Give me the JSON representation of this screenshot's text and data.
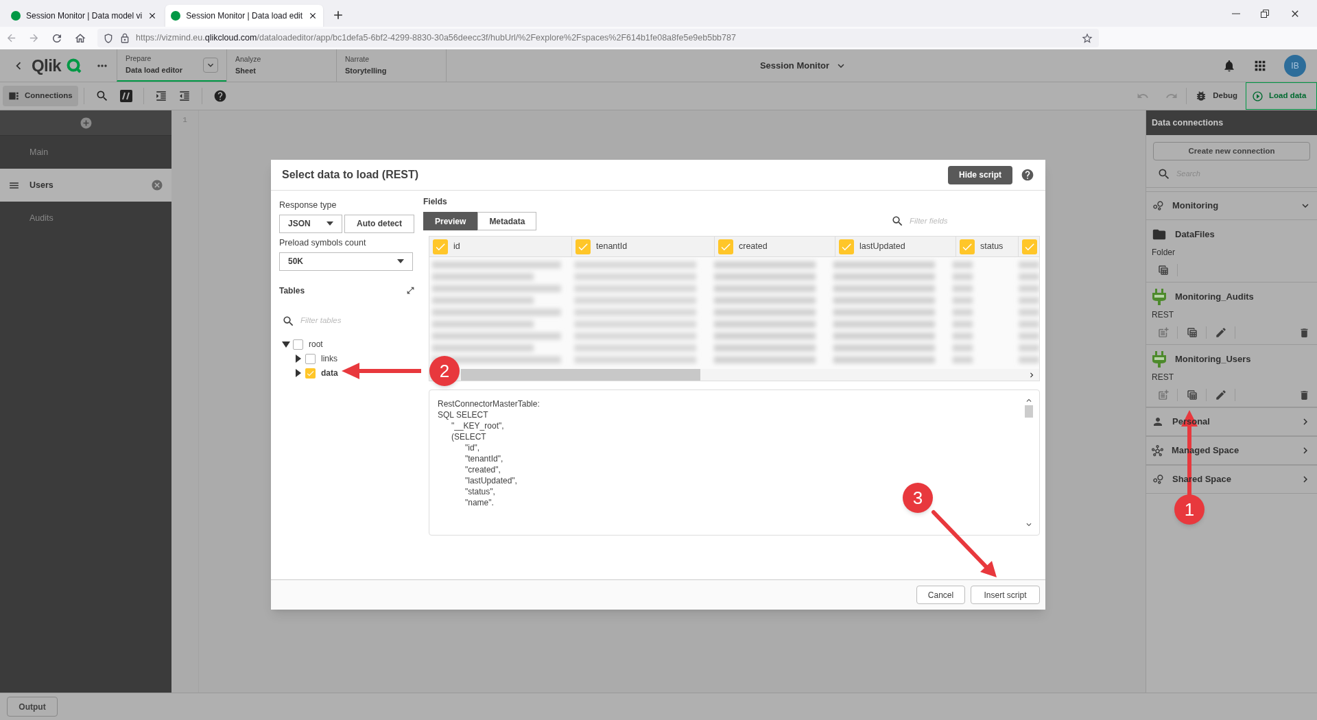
{
  "browser": {
    "tabs": [
      {
        "title": "Session Monitor | Data model vi",
        "selected": false
      },
      {
        "title": "Session Monitor | Data load edit",
        "selected": true
      }
    ],
    "url": {
      "prefix": "https://vizmind.eu.",
      "domain": "qlikcloud.com",
      "path": "/dataloadeditor/app/bc1defa5-6bf2-4299-8830-30a56deecc3f/hubUrl/%2Fexplore%2Fspaces%2F614b1fe08a8fe5e9eb5bb787"
    }
  },
  "header": {
    "logo": "Qlik",
    "nav": [
      {
        "section": "Prepare",
        "label": "Data load editor",
        "selected": true,
        "dropdown": true
      },
      {
        "section": "Analyze",
        "label": "Sheet",
        "selected": false,
        "dropdown": false
      },
      {
        "section": "Narrate",
        "label": "Storytelling",
        "selected": false,
        "dropdown": false
      }
    ],
    "app_title": "Session Monitor",
    "avatar": "IB"
  },
  "toolbar": {
    "connections": {
      "label": "Connections",
      "active": true
    },
    "undo_disabled": true,
    "redo_disabled": true,
    "debug": "Debug",
    "load_data": "Load data"
  },
  "sections": [
    {
      "name": "Main",
      "selected": false
    },
    {
      "name": "Users",
      "selected": true
    },
    {
      "name": "Audits",
      "selected": false
    }
  ],
  "editor": {
    "line_numbers": [
      "1"
    ]
  },
  "connections_panel": {
    "title": "Data connections",
    "create_button": "Create new connection",
    "search_placeholder": "Search",
    "spaces": [
      {
        "name": "Monitoring",
        "kind": "shared",
        "expanded": true,
        "connections": [
          {
            "name": "DataFiles",
            "type": "Folder",
            "kind": "folder"
          },
          {
            "name": "Monitoring_Audits",
            "type": "REST",
            "kind": "rest"
          },
          {
            "name": "Monitoring_Users",
            "type": "REST",
            "kind": "rest"
          }
        ]
      },
      {
        "name": "Personal",
        "kind": "personal",
        "expanded": false
      },
      {
        "name": "Managed Space",
        "kind": "managed",
        "expanded": false
      },
      {
        "name": "Shared Space",
        "kind": "shared",
        "expanded": false
      }
    ]
  },
  "dialog": {
    "title": "Select data to load (REST)",
    "hide_script": "Hide script",
    "response_type_label": "Response type",
    "response_type": "JSON",
    "auto_detect": "Auto detect",
    "preload_label": "Preload symbols count",
    "preload": "50K",
    "tables_label": "Tables",
    "tables_filter_placeholder": "Filter tables",
    "tables": [
      {
        "name": "root",
        "checked": false,
        "expanded": true,
        "children": [
          {
            "name": "links",
            "checked": false,
            "expanded": false
          },
          {
            "name": "data",
            "checked": true,
            "expanded": false
          }
        ]
      }
    ],
    "fields_label": "Fields",
    "tabs": [
      {
        "label": "Preview",
        "selected": true
      },
      {
        "label": "Metadata",
        "selected": false
      }
    ],
    "fields_filter_placeholder": "Filter fields",
    "columns": [
      {
        "label": "id",
        "checked": true
      },
      {
        "label": "tenantId",
        "checked": true
      },
      {
        "label": "created",
        "checked": true
      },
      {
        "label": "lastUpdated",
        "checked": true
      },
      {
        "label": "status",
        "checked": true
      },
      {
        "checked": true
      }
    ],
    "preview": {
      "kind": "picture"
    },
    "script_lines": [
      "RestConnectorMasterTable:",
      "SQL SELECT",
      "      \"__KEY_root\",",
      "      (SELECT",
      "            \"id\",",
      "            \"tenantId\",",
      "            \"created\",",
      "            \"lastUpdated\",",
      "            \"status\",",
      "            \"name\"."
    ],
    "buttons": [
      "Cancel",
      "Insert script"
    ]
  },
  "output_button": "Output",
  "annotations": [
    {
      "label": "1"
    },
    {
      "label": "2"
    },
    {
      "label": "3"
    }
  ]
}
